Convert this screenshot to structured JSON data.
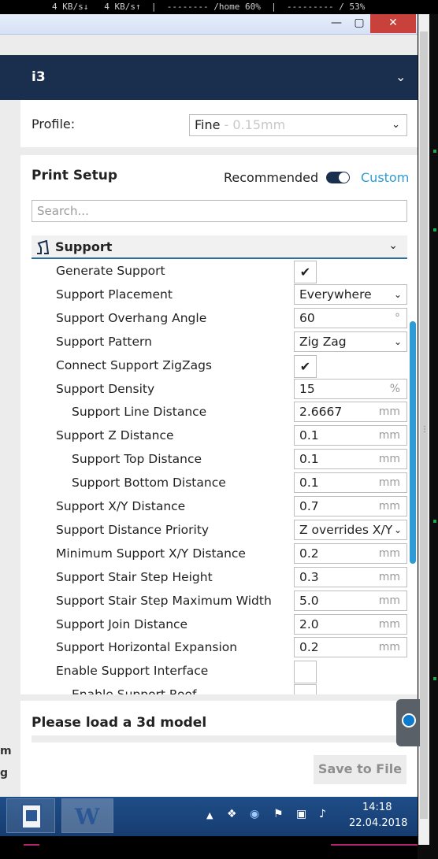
{
  "statusbar": {
    "text": "4 KB/s↓   4 KB/s↑  |  -------- /home 60%  |  --------- / 53%"
  },
  "window": {
    "minimize_glyph": "—",
    "maximize_glyph": "▢",
    "close_glyph": "✕"
  },
  "machine": {
    "name": "i3",
    "chevron": "⌄"
  },
  "profile": {
    "label": "Profile:",
    "value": "Fine",
    "detail": " - 0.15mm",
    "chevron": "⌄"
  },
  "print_setup": {
    "title": "Print Setup",
    "recommended_label": "Recommended",
    "custom_label": "Custom",
    "search_placeholder": "Search..."
  },
  "category": {
    "label": "Support",
    "chevron": "⌄"
  },
  "settings": [
    {
      "name": "Generate Support",
      "indent": 0,
      "type": "checkbox",
      "checked": true
    },
    {
      "name": "Support Placement",
      "indent": 0,
      "type": "dropdown",
      "value": "Everywhere"
    },
    {
      "name": "Support Overhang Angle",
      "indent": 0,
      "type": "field",
      "value": "60",
      "unit": "°"
    },
    {
      "name": "Support Pattern",
      "indent": 0,
      "type": "dropdown",
      "value": "Zig Zag"
    },
    {
      "name": "Connect Support ZigZags",
      "indent": 0,
      "type": "checkbox",
      "checked": true
    },
    {
      "name": "Support Density",
      "indent": 0,
      "type": "field",
      "value": "15",
      "unit": "%"
    },
    {
      "name": "Support Line Distance",
      "indent": 1,
      "type": "field",
      "value": "2.6667",
      "unit": "mm"
    },
    {
      "name": "Support Z Distance",
      "indent": 0,
      "type": "field",
      "value": "0.1",
      "unit": "mm"
    },
    {
      "name": "Support Top Distance",
      "indent": 1,
      "type": "field",
      "value": "0.1",
      "unit": "mm"
    },
    {
      "name": "Support Bottom Distance",
      "indent": 1,
      "type": "field",
      "value": "0.1",
      "unit": "mm"
    },
    {
      "name": "Support X/Y Distance",
      "indent": 0,
      "type": "field",
      "value": "0.7",
      "unit": "mm"
    },
    {
      "name": "Support Distance Priority",
      "indent": 0,
      "type": "dropdown",
      "value": "Z overrides X/Y"
    },
    {
      "name": "Minimum Support X/Y Distance",
      "indent": 0,
      "type": "field",
      "value": "0.2",
      "unit": "mm"
    },
    {
      "name": "Support Stair Step Height",
      "indent": 0,
      "type": "field",
      "value": "0.3",
      "unit": "mm"
    },
    {
      "name": "Support Stair Step Maximum Width",
      "indent": 0,
      "type": "field",
      "value": "5.0",
      "unit": "mm"
    },
    {
      "name": "Support Join Distance",
      "indent": 0,
      "type": "field",
      "value": "2.0",
      "unit": "mm"
    },
    {
      "name": "Support Horizontal Expansion",
      "indent": 0,
      "type": "field",
      "value": "0.2",
      "unit": "mm"
    },
    {
      "name": "Enable Support Interface",
      "indent": 0,
      "type": "checkbox",
      "checked": false
    },
    {
      "name": "Enable Support Roof",
      "indent": 1,
      "type": "checkbox",
      "checked": false
    }
  ],
  "bottom": {
    "message": "Please load a 3d model",
    "save_label": "Save to File"
  },
  "gutter_fragments": [
    "m",
    "g"
  ],
  "taskbar": {
    "time": "14:18",
    "date": "22.04.2018",
    "word_glyph": "W",
    "tray_icons": [
      "▲",
      "❖",
      "◉",
      "⚑",
      "▣",
      "♪"
    ]
  },
  "colors": {
    "accent": "#2d9bd5",
    "navy": "#1a2e4e",
    "close": "#c8413a"
  }
}
